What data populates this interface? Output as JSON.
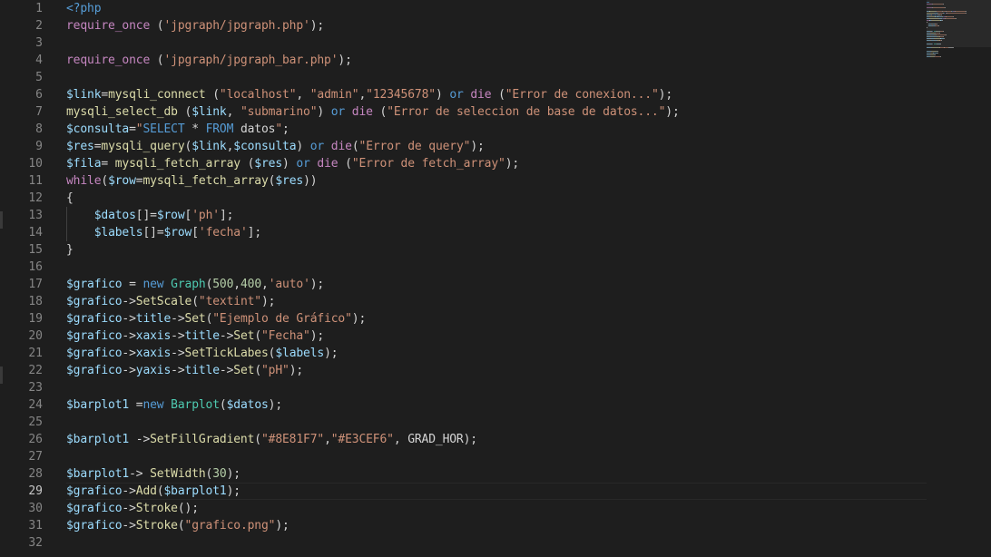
{
  "colors": {
    "background": "#1e1e1e",
    "line_number": "#858585",
    "line_number_active": "#c6c6c6",
    "default": "#d4d4d4",
    "keyword": "#569cd6",
    "control": "#c586c0",
    "function": "#dcdcaa",
    "variable": "#9cdcfe",
    "string": "#ce9178",
    "number": "#b5cea8",
    "class": "#4ec9b0",
    "constant": "#4fc1ff"
  },
  "active_line": 29,
  "line_numbers": [
    "1",
    "2",
    "3",
    "4",
    "5",
    "6",
    "7",
    "8",
    "9",
    "10",
    "11",
    "12",
    "13",
    "14",
    "15",
    "16",
    "17",
    "18",
    "19",
    "20",
    "21",
    "22",
    "23",
    "24",
    "25",
    "26",
    "27",
    "28",
    "29",
    "30",
    "31",
    "32"
  ],
  "lines": [
    [
      [
        "<?php",
        "keyword"
      ]
    ],
    [
      [
        "require_once",
        "control"
      ],
      [
        " (",
        "default"
      ],
      [
        "'jpgraph/jpgraph.php'",
        "string"
      ],
      [
        ");",
        "default"
      ]
    ],
    [],
    [
      [
        "require_once",
        "control"
      ],
      [
        " (",
        "default"
      ],
      [
        "'jpgraph/jpgraph_bar.php'",
        "string"
      ],
      [
        ");",
        "default"
      ]
    ],
    [],
    [
      [
        "$link",
        "variable"
      ],
      [
        "=",
        "default"
      ],
      [
        "mysqli_connect",
        "function"
      ],
      [
        " (",
        "default"
      ],
      [
        "\"localhost\"",
        "string"
      ],
      [
        ", ",
        "default"
      ],
      [
        "\"admin\"",
        "string"
      ],
      [
        ",",
        "default"
      ],
      [
        "\"12345678\"",
        "string"
      ],
      [
        ") ",
        "default"
      ],
      [
        "or",
        "keyword"
      ],
      [
        " ",
        "default"
      ],
      [
        "die",
        "control"
      ],
      [
        " (",
        "default"
      ],
      [
        "\"Error de conexion...\"",
        "string"
      ],
      [
        ");",
        "default"
      ]
    ],
    [
      [
        "mysqli_select_db",
        "function"
      ],
      [
        " (",
        "default"
      ],
      [
        "$link",
        "variable"
      ],
      [
        ", ",
        "default"
      ],
      [
        "\"submarino\"",
        "string"
      ],
      [
        ") ",
        "default"
      ],
      [
        "or",
        "keyword"
      ],
      [
        " ",
        "default"
      ],
      [
        "die",
        "control"
      ],
      [
        " (",
        "default"
      ],
      [
        "\"Error de seleccion de base de datos...\"",
        "string"
      ],
      [
        ");",
        "default"
      ]
    ],
    [
      [
        "$consulta",
        "variable"
      ],
      [
        "=",
        "default"
      ],
      [
        "\"",
        "string"
      ],
      [
        "SELECT",
        "keyword"
      ],
      [
        " * ",
        "default"
      ],
      [
        "FROM",
        "keyword"
      ],
      [
        " datos",
        "default"
      ],
      [
        "\"",
        "string"
      ],
      [
        ";",
        "default"
      ]
    ],
    [
      [
        "$res",
        "variable"
      ],
      [
        "=",
        "default"
      ],
      [
        "mysqli_query",
        "function"
      ],
      [
        "(",
        "default"
      ],
      [
        "$link",
        "variable"
      ],
      [
        ",",
        "default"
      ],
      [
        "$consulta",
        "variable"
      ],
      [
        ") ",
        "default"
      ],
      [
        "or",
        "keyword"
      ],
      [
        " ",
        "default"
      ],
      [
        "die",
        "control"
      ],
      [
        "(",
        "default"
      ],
      [
        "\"Error de query\"",
        "string"
      ],
      [
        ");",
        "default"
      ]
    ],
    [
      [
        "$fila",
        "variable"
      ],
      [
        "= ",
        "default"
      ],
      [
        "mysqli_fetch_array",
        "function"
      ],
      [
        " (",
        "default"
      ],
      [
        "$res",
        "variable"
      ],
      [
        ") ",
        "default"
      ],
      [
        "or",
        "keyword"
      ],
      [
        " ",
        "default"
      ],
      [
        "die",
        "control"
      ],
      [
        " (",
        "default"
      ],
      [
        "\"Error de fetch_array\"",
        "string"
      ],
      [
        ");",
        "default"
      ]
    ],
    [
      [
        "while",
        "control"
      ],
      [
        "(",
        "default"
      ],
      [
        "$row",
        "variable"
      ],
      [
        "=",
        "default"
      ],
      [
        "mysqli_fetch_array",
        "function"
      ],
      [
        "(",
        "default"
      ],
      [
        "$res",
        "variable"
      ],
      [
        "))",
        "default"
      ]
    ],
    [
      [
        "{",
        "default"
      ]
    ],
    [
      [
        "    ",
        "default"
      ],
      [
        "$datos",
        "variable"
      ],
      [
        "[]=",
        "default"
      ],
      [
        "$row",
        "variable"
      ],
      [
        "[",
        "default"
      ],
      [
        "'ph'",
        "string"
      ],
      [
        "];",
        "default"
      ]
    ],
    [
      [
        "    ",
        "default"
      ],
      [
        "$labels",
        "variable"
      ],
      [
        "[]=",
        "default"
      ],
      [
        "$row",
        "variable"
      ],
      [
        "[",
        "default"
      ],
      [
        "'fecha'",
        "string"
      ],
      [
        "];",
        "default"
      ]
    ],
    [
      [
        "}",
        "default"
      ]
    ],
    [],
    [
      [
        "$grafico",
        "variable"
      ],
      [
        " = ",
        "default"
      ],
      [
        "new",
        "keyword"
      ],
      [
        " ",
        "default"
      ],
      [
        "Graph",
        "class"
      ],
      [
        "(",
        "default"
      ],
      [
        "500",
        "number"
      ],
      [
        ",",
        "default"
      ],
      [
        "400",
        "number"
      ],
      [
        ",",
        "default"
      ],
      [
        "'auto'",
        "string"
      ],
      [
        ");",
        "default"
      ]
    ],
    [
      [
        "$grafico",
        "variable"
      ],
      [
        "->",
        "default"
      ],
      [
        "SetScale",
        "function"
      ],
      [
        "(",
        "default"
      ],
      [
        "\"textint\"",
        "string"
      ],
      [
        ");",
        "default"
      ]
    ],
    [
      [
        "$grafico",
        "variable"
      ],
      [
        "->",
        "default"
      ],
      [
        "title",
        "variable"
      ],
      [
        "->",
        "default"
      ],
      [
        "Set",
        "function"
      ],
      [
        "(",
        "default"
      ],
      [
        "\"Ejemplo de Gráfico\"",
        "string"
      ],
      [
        ");",
        "default"
      ]
    ],
    [
      [
        "$grafico",
        "variable"
      ],
      [
        "->",
        "default"
      ],
      [
        "xaxis",
        "variable"
      ],
      [
        "->",
        "default"
      ],
      [
        "title",
        "variable"
      ],
      [
        "->",
        "default"
      ],
      [
        "Set",
        "function"
      ],
      [
        "(",
        "default"
      ],
      [
        "\"Fecha\"",
        "string"
      ],
      [
        ");",
        "default"
      ]
    ],
    [
      [
        "$grafico",
        "variable"
      ],
      [
        "->",
        "default"
      ],
      [
        "xaxis",
        "variable"
      ],
      [
        "->",
        "default"
      ],
      [
        "SetTickLabes",
        "function"
      ],
      [
        "(",
        "default"
      ],
      [
        "$labels",
        "variable"
      ],
      [
        ");",
        "default"
      ]
    ],
    [
      [
        "$grafico",
        "variable"
      ],
      [
        "->",
        "default"
      ],
      [
        "yaxis",
        "variable"
      ],
      [
        "->",
        "default"
      ],
      [
        "title",
        "variable"
      ],
      [
        "->",
        "default"
      ],
      [
        "Set",
        "function"
      ],
      [
        "(",
        "default"
      ],
      [
        "\"pH\"",
        "string"
      ],
      [
        ");",
        "default"
      ]
    ],
    [],
    [
      [
        "$barplot1",
        "variable"
      ],
      [
        " =",
        "default"
      ],
      [
        "new",
        "keyword"
      ],
      [
        " ",
        "default"
      ],
      [
        "Barplot",
        "class"
      ],
      [
        "(",
        "default"
      ],
      [
        "$datos",
        "variable"
      ],
      [
        ");",
        "default"
      ]
    ],
    [],
    [
      [
        "$barplot1",
        "variable"
      ],
      [
        " ->",
        "default"
      ],
      [
        "SetFillGradient",
        "function"
      ],
      [
        "(",
        "default"
      ],
      [
        "\"#8E81F7\"",
        "string"
      ],
      [
        ",",
        "default"
      ],
      [
        "\"#E3CEF6\"",
        "string"
      ],
      [
        ", GRAD_HOR);",
        "default"
      ]
    ],
    [],
    [
      [
        "$barplot1",
        "variable"
      ],
      [
        "-> ",
        "default"
      ],
      [
        "SetWidth",
        "function"
      ],
      [
        "(",
        "default"
      ],
      [
        "30",
        "number"
      ],
      [
        ");",
        "default"
      ]
    ],
    [
      [
        "$grafico",
        "variable"
      ],
      [
        "->",
        "default"
      ],
      [
        "Add",
        "function"
      ],
      [
        "(",
        "default"
      ],
      [
        "$barplot1",
        "variable"
      ],
      [
        ");",
        "default"
      ]
    ],
    [
      [
        "$grafico",
        "variable"
      ],
      [
        "->",
        "default"
      ],
      [
        "Stroke",
        "function"
      ],
      [
        "();",
        "default"
      ]
    ],
    [
      [
        "$grafico",
        "variable"
      ],
      [
        "->",
        "default"
      ],
      [
        "Stroke",
        "function"
      ],
      [
        "(",
        "default"
      ],
      [
        "\"grafico.png\"",
        "string"
      ],
      [
        ");",
        "default"
      ]
    ],
    []
  ]
}
